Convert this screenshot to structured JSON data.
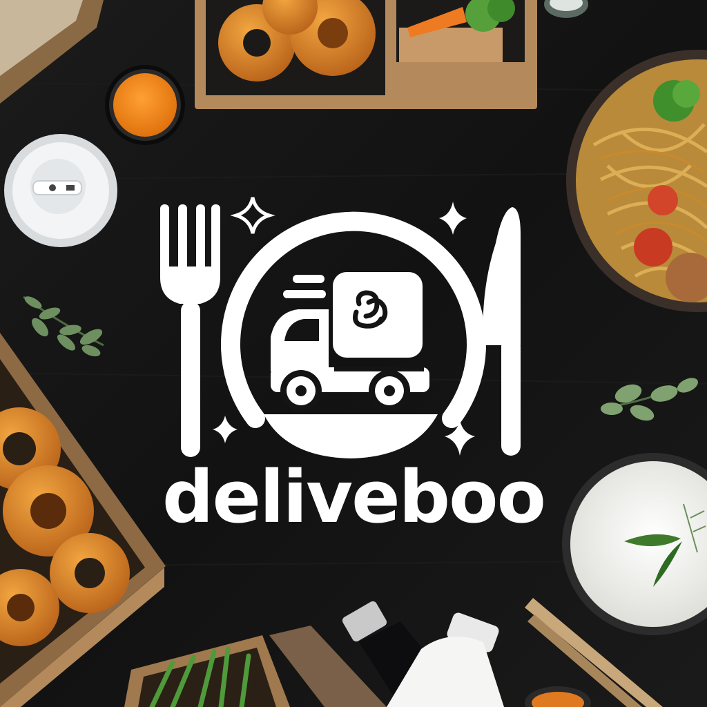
{
  "brand": {
    "name": "deliveboo",
    "logo_icons": [
      "fork-icon",
      "knife-icon",
      "plate-icon",
      "delivery-truck-icon",
      "sparkle-icon"
    ],
    "logo_color": "#ffffff"
  },
  "background": {
    "surface_color": "#141414",
    "props": [
      "onion-rings-box-top",
      "carrot-broccoli-compartment",
      "orange-sauce-cup",
      "white-coffee-lid",
      "herb-sprig-left",
      "onion-rings-box-left",
      "noodle-bowl-right",
      "herb-sprig-right",
      "cream-soup-bowl",
      "chopsticks",
      "dark-sauce-bottle",
      "white-milk-bottle",
      "green-beans-box",
      "small-cup-bottom"
    ]
  }
}
